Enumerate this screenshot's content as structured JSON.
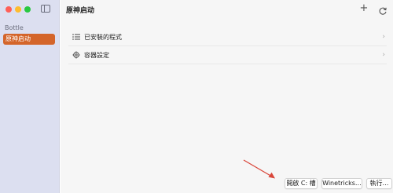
{
  "sidebar": {
    "section_label": "Bottle",
    "items": [
      {
        "label": "原神启动",
        "selected": true
      }
    ],
    "toggle_icon": "sidebar-toggle-icon"
  },
  "header": {
    "title": "原神启动",
    "add_icon": "plus-icon",
    "refresh_icon": "refresh-icon"
  },
  "main": {
    "rows": [
      {
        "label": "已安裝的程式",
        "icon": "list-icon"
      },
      {
        "label": "容器設定",
        "icon": "gear-icon"
      }
    ]
  },
  "actions": {
    "open_c": "開啟 C: 槽",
    "winetricks": "Winetricks…",
    "run": "執行…"
  },
  "colors": {
    "accent": "#d4652a",
    "sidebar_bg": "#dcdff0",
    "arrow": "#d9463a"
  }
}
